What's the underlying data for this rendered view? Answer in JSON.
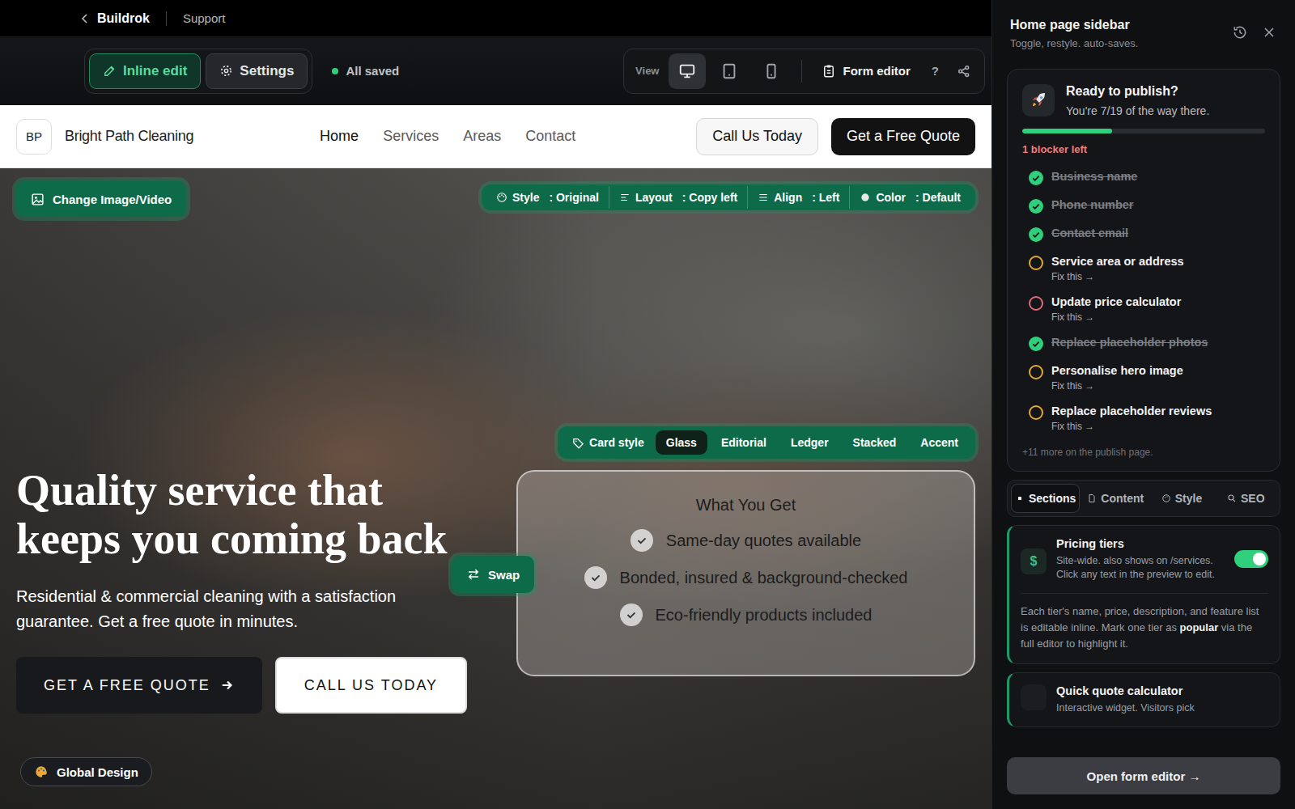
{
  "topbar": {
    "brand": "Buildrok",
    "link": "Support"
  },
  "toolbar": {
    "modes": [
      {
        "label": "Inline edit",
        "kind": "pencil",
        "selected": true
      },
      {
        "label": "Settings",
        "kind": "gear",
        "selected": false
      }
    ],
    "status": "All saved",
    "view_label": "View",
    "devices": [
      {
        "kind": "desktop",
        "selected": true
      },
      {
        "kind": "tablet",
        "selected": false
      },
      {
        "kind": "mobile",
        "selected": false
      }
    ],
    "form_editor": "Form editor",
    "help": "?"
  },
  "site": {
    "logo": "BP",
    "name": "Bright Path Cleaning",
    "nav": [
      {
        "label": "Home",
        "selected": true
      },
      {
        "label": "Services",
        "selected": false
      },
      {
        "label": "Areas",
        "selected": false
      },
      {
        "label": "Contact",
        "selected": false
      }
    ],
    "call": "Call Us Today",
    "quote": "Get a Free Quote"
  },
  "hero": {
    "change_media": "Change Image/Video",
    "controls": [
      {
        "kind": "style",
        "label": "Style",
        "value": ": Original"
      },
      {
        "kind": "layout",
        "label": "Layout",
        "value": ": Copy left"
      },
      {
        "kind": "align",
        "label": "Align",
        "value": ": Left"
      },
      {
        "kind": "color",
        "label": "Color",
        "value": ": Default"
      }
    ],
    "card_style": {
      "label": "Card style",
      "options": [
        {
          "label": "Glass",
          "selected": true
        },
        {
          "label": "Editorial",
          "selected": false
        },
        {
          "label": "Ledger",
          "selected": false
        },
        {
          "label": "Stacked",
          "selected": false
        },
        {
          "label": "Accent",
          "selected": false
        }
      ]
    },
    "card": {
      "title": "What You Get",
      "items": [
        "Same-day quotes available",
        "Bonded, insured & background-checked",
        "Eco-friendly products included"
      ]
    },
    "swap": "Swap",
    "headline": "Quality service that keeps you coming back",
    "subtext": "Residential & commercial cleaning with a satisfaction guarantee. Get a free quote in minutes.",
    "primary": "GET A FREE QUOTE",
    "secondary": "CALL US TODAY",
    "global_design": "Global Design"
  },
  "sidebar": {
    "title": "Home page sidebar",
    "subtitle": "Toggle, restyle. auto-saves.",
    "publish": {
      "title": "Ready to publish?",
      "subtitle": "You're 7/19 of the way there.",
      "level": 0.37,
      "blockers": "1 blocker left",
      "items": [
        {
          "label": "Business name",
          "status": "done",
          "fix": ""
        },
        {
          "label": "Phone number",
          "status": "done",
          "fix": ""
        },
        {
          "label": "Contact email",
          "status": "done",
          "fix": ""
        },
        {
          "label": "Service area or address",
          "status": "pending",
          "fix": "Fix this →"
        },
        {
          "label": "Update price calculator",
          "status": "blocker",
          "fix": "Fix this →"
        },
        {
          "label": "Replace placeholder photos",
          "status": "done",
          "fix": ""
        },
        {
          "label": "Personalise hero image",
          "status": "pending",
          "fix": "Fix this →"
        },
        {
          "label": "Replace placeholder reviews",
          "status": "pending",
          "fix": "Fix this →"
        }
      ],
      "more": "+11 more on the publish page."
    },
    "tabs": [
      {
        "label": "Sections",
        "kind": "dot",
        "selected": true
      },
      {
        "label": "Content",
        "kind": "doc",
        "selected": false
      },
      {
        "label": "Style",
        "kind": "palette",
        "selected": false
      },
      {
        "label": "SEO",
        "kind": "search",
        "selected": false
      }
    ],
    "sections": [
      {
        "title": "Pricing tiers",
        "icon": "$",
        "description": "Site-wide. also shows on /services. Click any text in the preview to edit.",
        "on": true,
        "note": [
          {
            "text": "Each tier's name, price, description, and feature list is editable inline. Mark one tier as ",
            "bold": false
          },
          {
            "text": "popular",
            "bold": true
          },
          {
            "text": " via the full editor to highlight it.",
            "bold": false
          }
        ]
      },
      {
        "title": "Quick quote calculator",
        "icon": "",
        "description": "Interactive widget. Visitors pick"
      }
    ],
    "footer_button": "Open form editor →"
  }
}
